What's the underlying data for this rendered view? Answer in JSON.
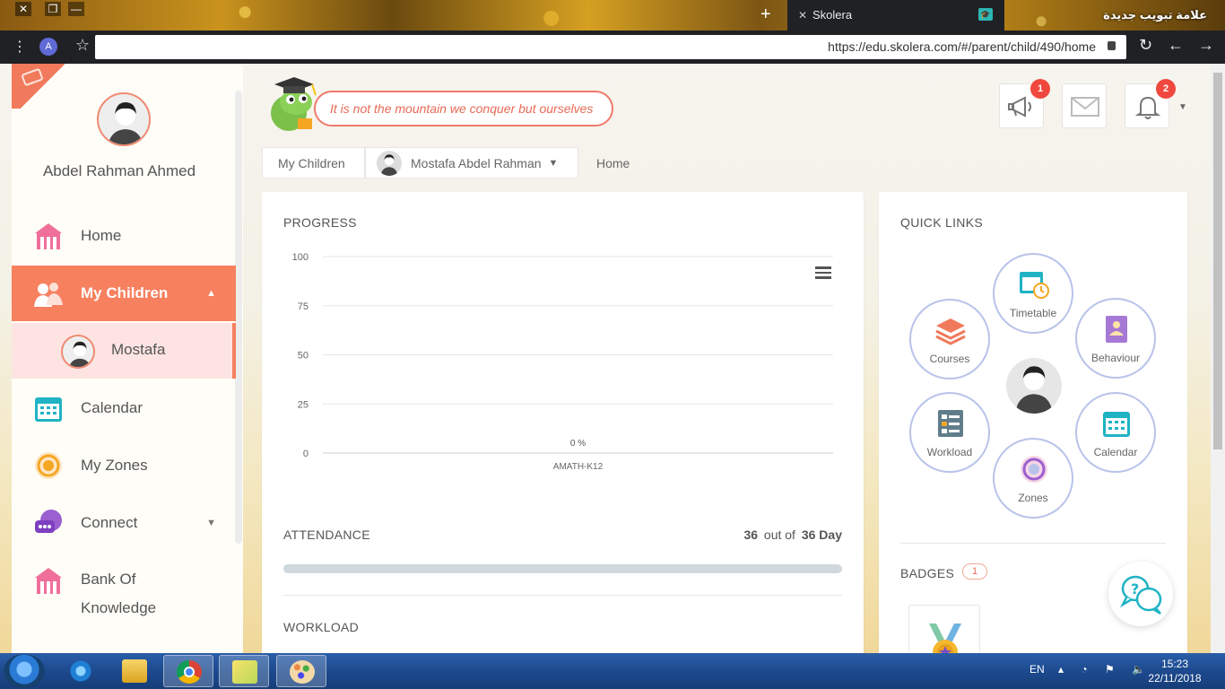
{
  "browser": {
    "tab_title": "Skolera",
    "other_tab_title": "علامة تبويب جديدة",
    "url": "https://edu.skolera.com/#/parent/child/490/home",
    "profile_initial": "A"
  },
  "sidebar": {
    "user_name": "Abdel Rahman Ahmed",
    "items": [
      {
        "label": "Home"
      },
      {
        "label": "My Children"
      },
      {
        "label": "Mostafa"
      },
      {
        "label": "Calendar"
      },
      {
        "label": "My Zones"
      },
      {
        "label": "Connect"
      },
      {
        "label": "Bank Of"
      },
      {
        "label": "Knowledge"
      }
    ]
  },
  "header": {
    "quote": "It is not the mountain we conquer but ourselves",
    "announcements_badge": "1",
    "notifications_badge": "2"
  },
  "breadcrumb": {
    "root": "My Children",
    "child": "Mostafa Abdel Rahman",
    "current": "Home"
  },
  "progress": {
    "title": "PROGRESS",
    "chart_data": {
      "type": "bar",
      "categories": [
        "AMATH-K12"
      ],
      "values": [
        0
      ],
      "data_labels": [
        "0 %"
      ],
      "ylim": [
        0,
        100
      ],
      "yticks": [
        "100",
        "75",
        "50",
        "25",
        "0"
      ],
      "grid": true
    }
  },
  "attendance": {
    "title": "ATTENDANCE",
    "attended": "36",
    "out_of": "out of",
    "total": "36 Day"
  },
  "workload": {
    "title": "WORKLOAD"
  },
  "quick_links": {
    "title": "QUICK LINKS",
    "items": [
      {
        "label": "Timetable"
      },
      {
        "label": "Courses"
      },
      {
        "label": "Behaviour"
      },
      {
        "label": "Workload"
      },
      {
        "label": "Calendar"
      },
      {
        "label": "Zones"
      }
    ]
  },
  "badges": {
    "title": "BADGES",
    "count": "1"
  },
  "taskbar": {
    "language": "EN",
    "time": "15:23",
    "date": "22/11/2018"
  },
  "colors": {
    "accent": "#f7805f",
    "badge_red": "#f0483e",
    "quick_link_border": "#b9c3ea"
  }
}
